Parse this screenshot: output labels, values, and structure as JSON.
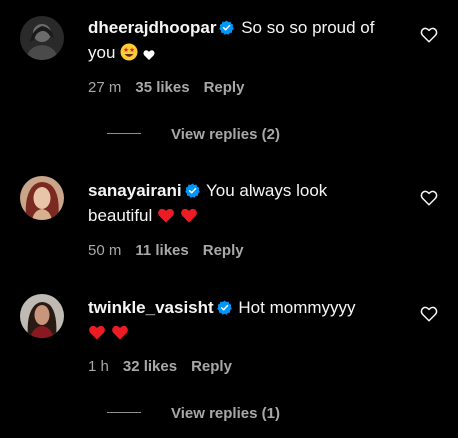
{
  "colors": {
    "background": "#000000",
    "text": "#f5f5f5",
    "muted": "#a8a8a8",
    "verified": "#0095f6",
    "heart": "#ed1c24"
  },
  "comments": [
    {
      "username": "dheerajdhoopar",
      "verified": true,
      "text": "So so so proud of you",
      "emoji": [
        "star-struck-emoji",
        "white-heart-emoji"
      ],
      "time": "27 m",
      "likes": "35 likes",
      "reply": "Reply",
      "view_replies": "View replies (2)"
    },
    {
      "username": "sanayairani",
      "verified": true,
      "text": "You always look beautiful",
      "emoji": [
        "red-heart-emoji",
        "red-heart-emoji"
      ],
      "time": "50 m",
      "likes": "11 likes",
      "reply": "Reply"
    },
    {
      "username": "twinkle_vasisht",
      "verified": true,
      "text": "Hot mommyyyy",
      "emoji": [
        "red-heart-emoji",
        "red-heart-emoji"
      ],
      "time": "1 h",
      "likes": "32 likes",
      "reply": "Reply",
      "view_replies": "View replies (1)"
    }
  ]
}
